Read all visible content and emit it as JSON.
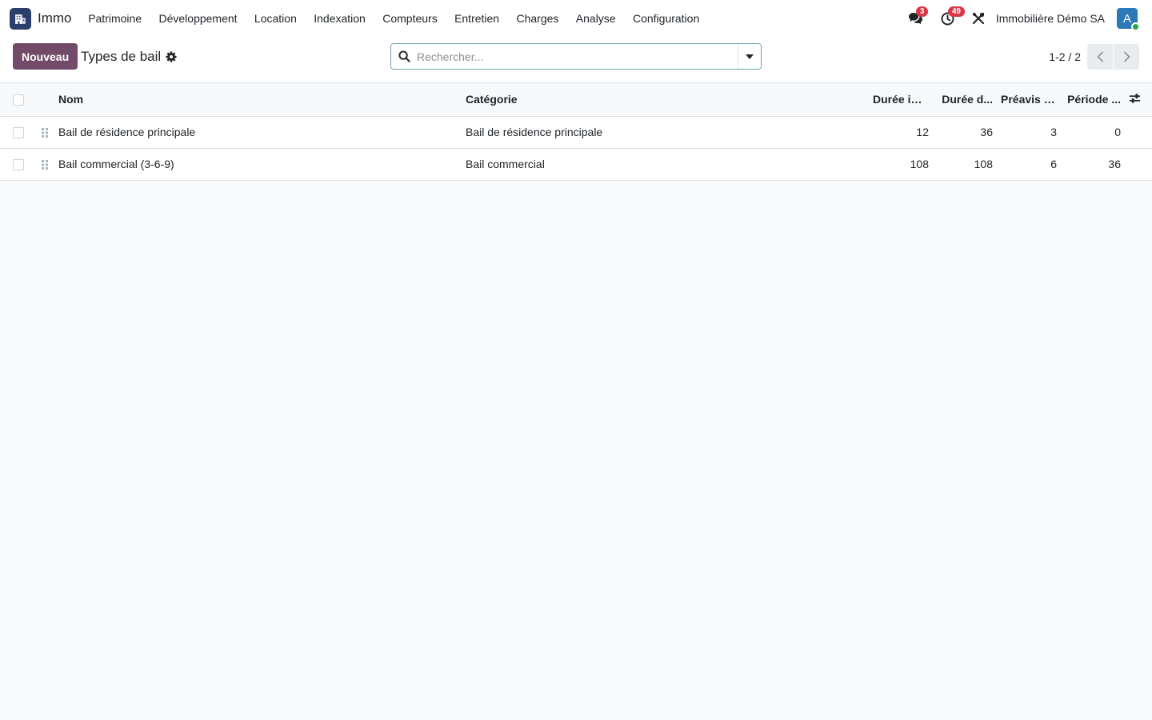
{
  "navbar": {
    "app_name": "Immo",
    "menu": [
      "Patrimoine",
      "Développement",
      "Location",
      "Indexation",
      "Compteurs",
      "Entretien",
      "Charges",
      "Analyse",
      "Configuration"
    ],
    "messages_count": "3",
    "activities_count": "49",
    "company": "Immobilière Démo SA",
    "avatar_initial": "A"
  },
  "control_panel": {
    "new_label": "Nouveau",
    "title": "Types de bail",
    "search_placeholder": "Rechercher...",
    "pager_value": "1-2 / 2"
  },
  "table": {
    "columns": [
      "Nom",
      "Catégorie",
      "Durée ini...",
      "Durée d...",
      "Préavis (...",
      "Période ..."
    ],
    "rows": [
      {
        "name": "Bail de résidence principale",
        "category": "Bail de résidence principale",
        "c1": "12",
        "c2": "36",
        "c3": "3",
        "c4": "0"
      },
      {
        "name": "Bail commercial (3-6-9)",
        "category": "Bail commercial",
        "c1": "108",
        "c2": "108",
        "c3": "6",
        "c4": "36"
      }
    ]
  },
  "colors": {
    "primary": "#714b67",
    "badge": "#dc3545",
    "avatar": "#2a7ab8",
    "logo": "#2c3e6b"
  }
}
